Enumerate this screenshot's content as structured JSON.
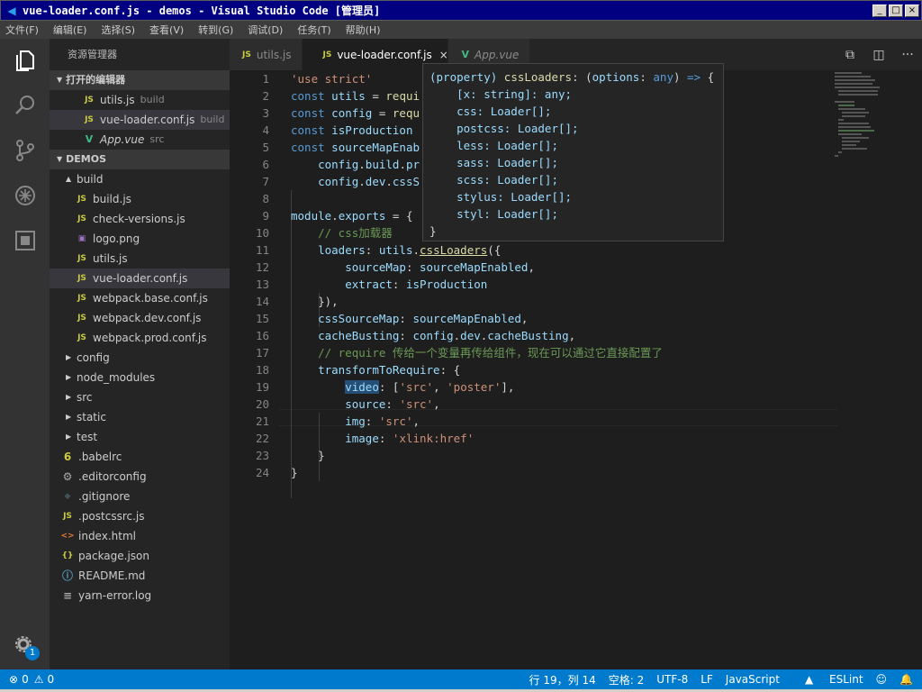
{
  "window": {
    "title": "vue-loader.conf.js - demos - Visual Studio Code [管理员]",
    "min": "_",
    "max": "□",
    "close": "×"
  },
  "menu": [
    "文件(F)",
    "编辑(E)",
    "选择(S)",
    "查看(V)",
    "转到(G)",
    "调试(D)",
    "任务(T)",
    "帮助(H)"
  ],
  "sidebar": {
    "title": "资源管理器",
    "open_editors_label": "打开的编辑器",
    "open_editors": [
      {
        "name": "utils.js",
        "suffix": "build",
        "icon": "JS"
      },
      {
        "name": "vue-loader.conf.js",
        "suffix": "build",
        "icon": "JS"
      },
      {
        "name": "App.vue",
        "suffix": "src",
        "icon": "V"
      }
    ],
    "workspace_label": "DEMOS",
    "tree": [
      {
        "name": "build",
        "icon": "▲"
      },
      {
        "name": "build.js",
        "icon": "JS"
      },
      {
        "name": "check-versions.js",
        "icon": "JS"
      },
      {
        "name": "logo.png",
        "icon": "▣"
      },
      {
        "name": "utils.js",
        "icon": "JS"
      },
      {
        "name": "vue-loader.conf.js",
        "icon": "JS"
      },
      {
        "name": "webpack.base.conf.js",
        "icon": "JS"
      },
      {
        "name": "webpack.dev.conf.js",
        "icon": "JS"
      },
      {
        "name": "webpack.prod.conf.js",
        "icon": "JS"
      },
      {
        "name": "config",
        "icon": "▶"
      },
      {
        "name": "node_modules",
        "icon": "▶"
      },
      {
        "name": "src",
        "icon": "▶"
      },
      {
        "name": "static",
        "icon": "▶"
      },
      {
        "name": "test",
        "icon": "▶"
      },
      {
        "name": ".babelrc",
        "icon": "6"
      },
      {
        "name": ".editorconfig",
        "icon": "⚙"
      },
      {
        "name": ".gitignore",
        "icon": "◆"
      },
      {
        "name": ".postcssrc.js",
        "icon": "JS"
      },
      {
        "name": "index.html",
        "icon": "<>"
      },
      {
        "name": "package.json",
        "icon": "{}"
      },
      {
        "name": "README.md",
        "icon": "ⓘ"
      },
      {
        "name": "yarn-error.log",
        "icon": "≡"
      }
    ]
  },
  "tabs": [
    {
      "name": "utils.js",
      "icon": "JS"
    },
    {
      "name": "vue-loader.conf.js",
      "icon": "JS",
      "close": "×"
    },
    {
      "name": "App.vue",
      "icon": "V"
    }
  ],
  "code": {
    "line_numbers": [
      "1",
      "2",
      "3",
      "4",
      "5",
      "6",
      "7",
      "8",
      "9",
      "10",
      "11",
      "12",
      "13",
      "14",
      "15",
      "16",
      "17",
      "18",
      "19",
      "20",
      "21",
      "22",
      "23",
      "24"
    ]
  },
  "hover": {
    "lines": [
      "(property) cssLoaders: (options: any) => {",
      "    [x: string]: any;",
      "    css: Loader[];",
      "    postcss: Loader[];",
      "    less: Loader[];",
      "    sass: Loader[];",
      "    scss: Loader[];",
      "    stylus: Loader[];",
      "    styl: Loader[];",
      "}"
    ]
  },
  "status": {
    "errors": "0",
    "warnings": "0",
    "position": "行 19，列 14",
    "spaces": "空格: 2",
    "encoding": "UTF-8",
    "eol": "LF",
    "language": "JavaScript",
    "eslint": "ESLint",
    "badge": "1"
  },
  "colors": {
    "statusbar": "#007acc",
    "activitybar": "#333333",
    "sidebar": "#252526",
    "editor": "#1e1e1e"
  }
}
